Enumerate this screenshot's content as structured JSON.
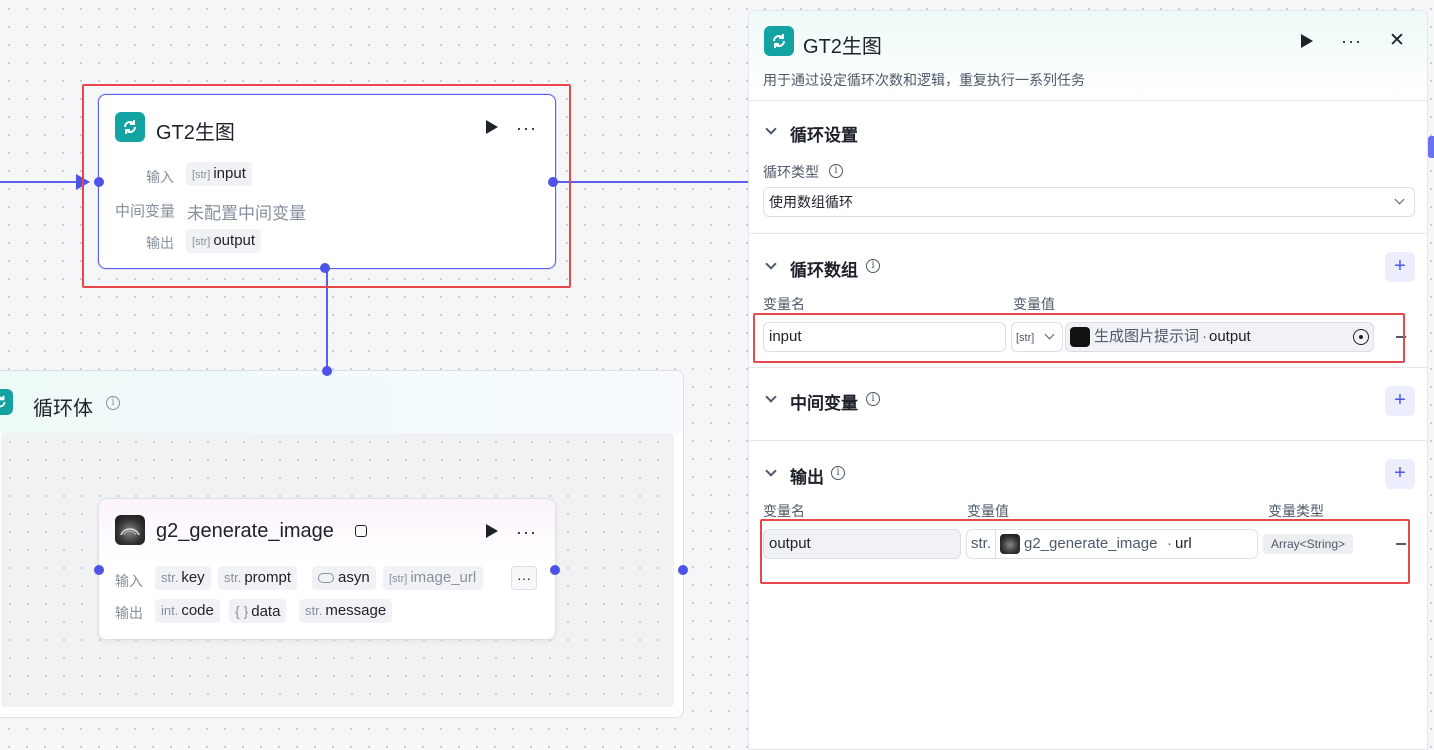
{
  "canvas": {
    "loop_node": {
      "title": "GT2生图",
      "input_label": "输入",
      "input_type": "[str]",
      "input_name": "input",
      "mid_label": "中间变量",
      "mid_value": "未配置中间变量",
      "output_label": "输出",
      "output_type": "[str]",
      "output_name": "output",
      "more": "···"
    },
    "loop_body": {
      "title": "循环体",
      "info": "i"
    },
    "plugin_node": {
      "title": "g2_generate_image",
      "input_label": "输入",
      "inputs": [
        {
          "type": "str.",
          "name": "key"
        },
        {
          "type": "str.",
          "name": "prompt"
        },
        {
          "type": "",
          "name": "asyn"
        },
        {
          "type": "[str]",
          "name": "image_url"
        }
      ],
      "output_label": "输出",
      "outputs": [
        {
          "type": "int.",
          "name": "code"
        },
        {
          "type": "{ }",
          "name": "data"
        },
        {
          "type": "str.",
          "name": "message"
        }
      ],
      "more": "···"
    }
  },
  "panel": {
    "title": "GT2生图",
    "description": "用于通过设定循环次数和逻辑，重复执行一系列任务",
    "more": "···",
    "close": "✕",
    "loop_settings": {
      "title": "循环设置",
      "type_label": "循环类型",
      "type_value": "使用数组循环"
    },
    "loop_array": {
      "title": "循环数组",
      "col_name": "变量名",
      "col_value": "变量值",
      "row": {
        "name": "input",
        "type": "[str]",
        "ref_node": "生成图片提示词",
        "ref_sep": "·",
        "ref_field": "output"
      }
    },
    "mid_vars": {
      "title": "中间变量"
    },
    "output": {
      "title": "输出",
      "col_name": "变量名",
      "col_value": "变量值",
      "col_type": "变量类型",
      "row": {
        "name": "output",
        "type": "str.",
        "ref_node": "g2_generate_image",
        "ref_sep": "·",
        "ref_field": "url",
        "var_type": "Array<String>"
      }
    },
    "plus": "+",
    "info": "i"
  },
  "colors": {
    "accent": "#4d53e8",
    "loop_icon": "#14a3a3",
    "highlight": "#e8474b"
  }
}
